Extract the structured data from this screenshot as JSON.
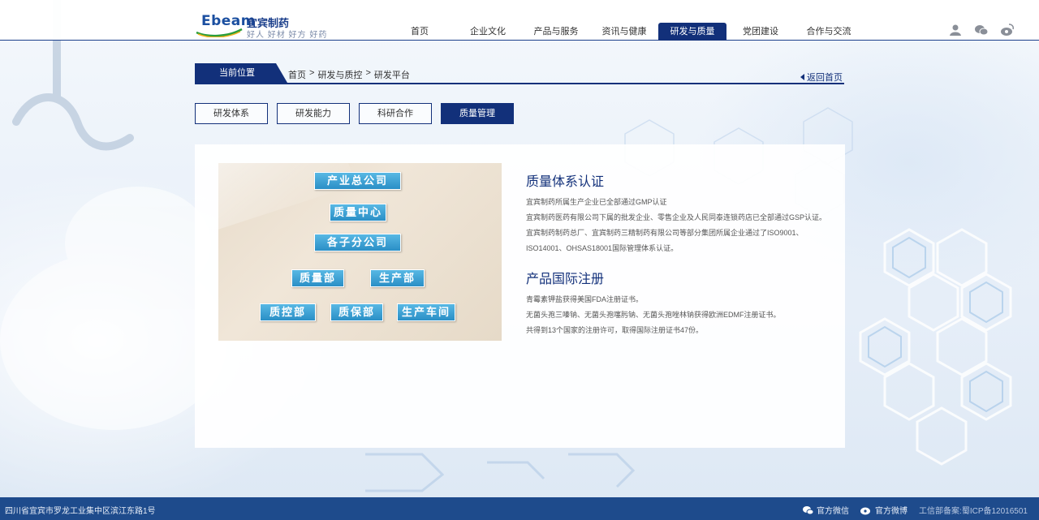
{
  "brand": {
    "logo_en": "Ebeam",
    "logo_cn": "宜宾制药",
    "slogan": "好人 好材  好方  好药"
  },
  "nav": {
    "items": [
      "首页",
      "企业文化",
      "产品与服务",
      "资讯与健康",
      "研发与质量",
      "党团建设",
      "合作与交流"
    ],
    "active": "研发与质量"
  },
  "header_icons": [
    "user-icon",
    "wechat-icon",
    "weibo-icon"
  ],
  "breadcrumb": {
    "label": "当前位置",
    "path": [
      "首页",
      "研发与质控",
      "研发平台"
    ],
    "separator": ">",
    "back_home": "返回首页"
  },
  "subtabs": {
    "items": [
      "研发体系",
      "研发能力",
      "科研合作",
      "质量管理"
    ],
    "active": "质量管理"
  },
  "org_chart": {
    "nodes": [
      "产业总公司",
      "质量中心",
      "各子分公司",
      "质量部",
      "生产部",
      "质控部",
      "质保部",
      "生产车间"
    ]
  },
  "sections": [
    {
      "title": "质量体系认证",
      "paragraphs": [
        "宜宾制药所属生产企业已全部通过GMP认证",
        "宜宾制药医药有限公司下属的批发企业、零售企业及人民同泰连锁药店已全部通过GSP认证。",
        "宜宾制药制药总厂、宜宾制药三精制药有限公司等部分集团所属企业通过了ISO9001、ISO14001、OHSAS18001国际管理体系认证。"
      ]
    },
    {
      "title": "产品国际注册",
      "paragraphs": [
        "青霉素钾盐获得美国FDA注册证书。",
        "无菌头孢三嗪钠、无菌头孢噻肟钠、无菌头孢唑林钠获得欧洲EDMF注册证书。",
        "共得到13个国家的注册许可，取得国际注册证书47份。"
      ]
    }
  ],
  "footer": {
    "address": "四川省宜宾市罗龙工业集中区滨江东路1号",
    "wechat": "官方微信",
    "weibo": "官方微博",
    "icp": "工信部备案:蜀ICP备12016501"
  },
  "colors": {
    "primary": "#12307a",
    "footer": "#1e4b8c",
    "org_box": "#2a8fc6"
  }
}
